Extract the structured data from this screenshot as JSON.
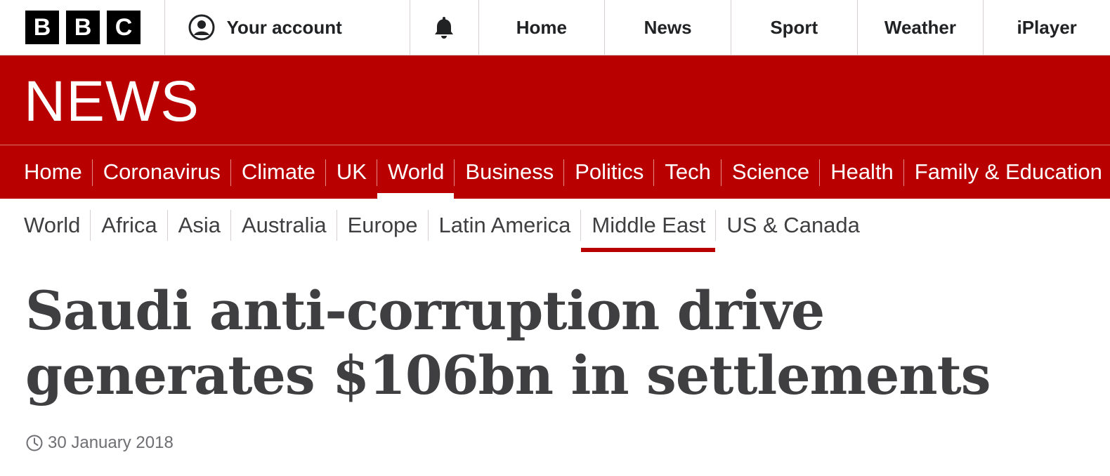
{
  "masthead": {
    "logo_letters": [
      "B",
      "B",
      "C"
    ],
    "account_label": "Your account",
    "account_icon": "user-circle-icon",
    "notification_icon": "bell-icon",
    "links": [
      "Home",
      "News",
      "Sport",
      "Weather",
      "iPlayer"
    ]
  },
  "banner": {
    "title": "NEWS",
    "color": "#b80000"
  },
  "primary_nav": {
    "items": [
      "Home",
      "Coronavirus",
      "Climate",
      "UK",
      "World",
      "Business",
      "Politics",
      "Tech",
      "Science",
      "Health",
      "Family & Education"
    ],
    "active": "World"
  },
  "secondary_nav": {
    "items": [
      "World",
      "Africa",
      "Asia",
      "Australia",
      "Europe",
      "Latin America",
      "Middle East",
      "US & Canada"
    ],
    "active": "Middle East"
  },
  "article": {
    "headline": "Saudi anti-corruption drive generates $106bn in settlements",
    "date": "30 January 2018",
    "date_icon": "clock-icon"
  }
}
